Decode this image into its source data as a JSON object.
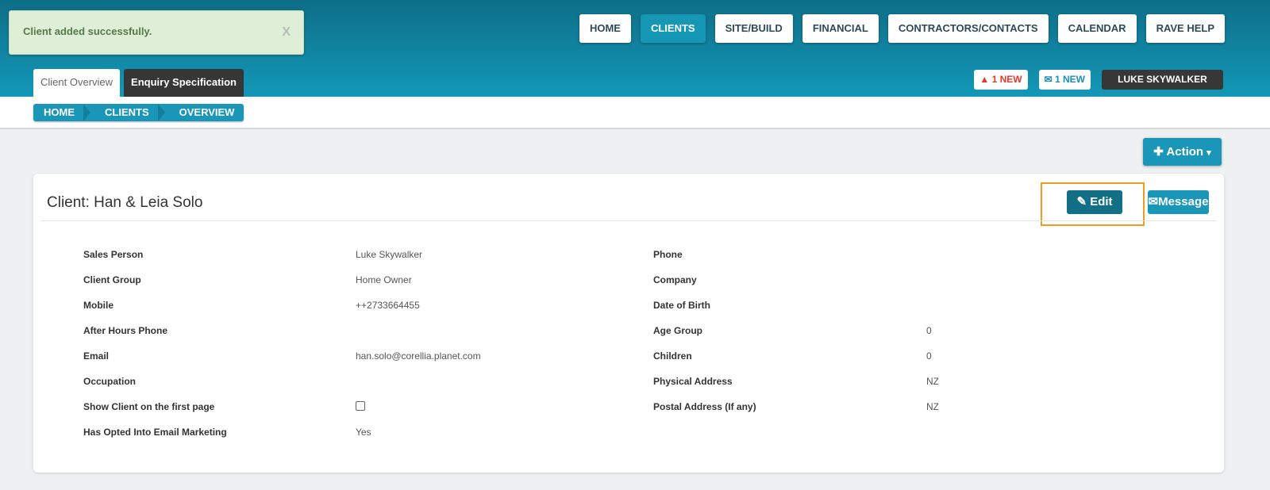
{
  "alert": {
    "message": "Client added successfully.",
    "close": "X"
  },
  "nav": [
    "HOME",
    "CLIENTS",
    "SITE/BUILD",
    "FINANCIAL",
    "CONTRACTORS/CONTACTS",
    "CALENDAR",
    "RAVE HELP"
  ],
  "tabs": [
    "Client Overview",
    "Enquiry Specification"
  ],
  "badges": {
    "alerts": "1 NEW",
    "messages": "1 NEW",
    "user": "LUKE SKYWALKER"
  },
  "breadcrumb": [
    "HOME",
    "CLIENTS",
    "OVERVIEW"
  ],
  "action_label": "Action",
  "card": {
    "title": "Client: Han & Leia Solo",
    "edit": "Edit",
    "message": "Message"
  },
  "left_fields": [
    {
      "label": "Sales Person",
      "value": "Luke Skywalker"
    },
    {
      "label": "Client Group",
      "value": "Home Owner"
    },
    {
      "label": "Mobile",
      "value": "++2733664455"
    },
    {
      "label": "After Hours Phone",
      "value": ""
    },
    {
      "label": "Email",
      "value": "han.solo@corellia.planet.com"
    },
    {
      "label": "Occupation",
      "value": ""
    },
    {
      "label": "Show Client on the first page",
      "value": ""
    },
    {
      "label": "Has Opted Into Email Marketing",
      "value": "Yes"
    }
  ],
  "right_fields": [
    {
      "label": "Phone",
      "value": ""
    },
    {
      "label": "Company",
      "value": ""
    },
    {
      "label": "Date of Birth",
      "value": ""
    },
    {
      "label": "Age Group",
      "value": "0"
    },
    {
      "label": "Children",
      "value": "0"
    },
    {
      "label": "Physical Address",
      "value": "NZ"
    },
    {
      "label": "Postal Address (If any)",
      "value": "NZ"
    }
  ]
}
